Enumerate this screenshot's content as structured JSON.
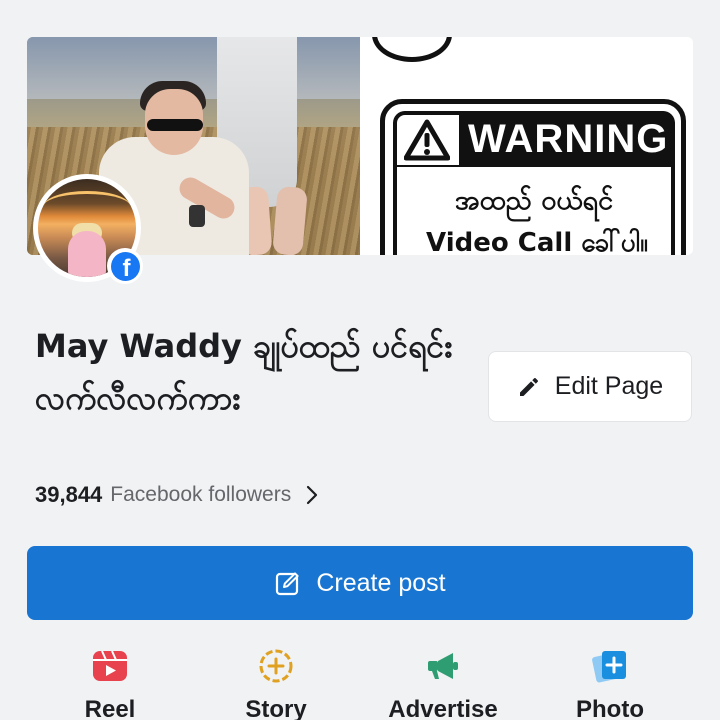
{
  "cover": {
    "warning_title": "WARNING",
    "warning_line1": "အထည် ဝယ်ရင်",
    "warning_line2": "Video Call ခေါ်ပါ။"
  },
  "profile": {
    "name": "May Waddy ချုပ်ထည် ပင်ရင်းလက်လီလက်ကား",
    "edit_label": "Edit Page",
    "followers_count": "39,844",
    "followers_label": "Facebook followers"
  },
  "create_post_label": "Create post",
  "actions": [
    {
      "label": "Reel",
      "icon": "reel-icon",
      "color": "#e8424f"
    },
    {
      "label": "Story",
      "icon": "story-plus-icon",
      "color": "#e0a020"
    },
    {
      "label": "Advertise",
      "icon": "megaphone-icon",
      "color": "#2e9e72"
    },
    {
      "label": "Photo",
      "icon": "photo-plus-icon",
      "color": "#1a8fe0"
    }
  ],
  "colors": {
    "primary": "#1876d2",
    "facebook_blue": "#1877f2",
    "background": "#f0f2f4"
  }
}
